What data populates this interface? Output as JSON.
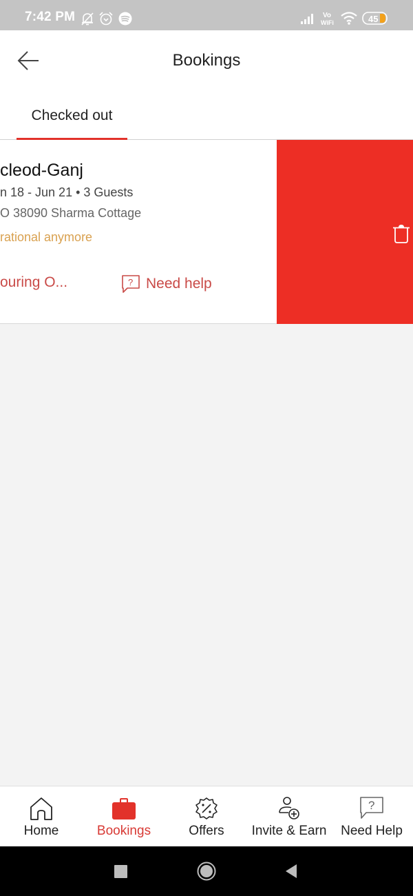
{
  "status_bar": {
    "time": "7:42 PM",
    "left_icons": [
      "bell-off-icon",
      "alarm-icon",
      "spotify-icon"
    ],
    "right_icons": [
      "signal-icon",
      "vowifi-icon",
      "wifi-icon",
      "battery-icon"
    ],
    "vowifi_text": "Vo WiFi",
    "battery_level": "45"
  },
  "app_bar": {
    "back_icon": "arrow-left-icon",
    "title": "Bookings"
  },
  "tabs": [
    {
      "label": "Checked out",
      "active": true
    }
  ],
  "booking_card": {
    "title": "cleod-Ganj",
    "dates_guests": "n 18 - Jun 21 • 3 Guests",
    "property": "O 38090 Sharma Cottage",
    "status": "rational anymore",
    "action_left": "ouring O...",
    "action_help": "Need help",
    "help_icon": "question-chat-icon"
  },
  "swipe_action": {
    "icon": "trash-icon",
    "color": "#ed2e25"
  },
  "bottom_nav": {
    "items": [
      {
        "label": "Home",
        "icon": "home-icon",
        "active": false
      },
      {
        "label": "Bookings",
        "icon": "briefcase-icon",
        "active": true
      },
      {
        "label": "Offers",
        "icon": "discount-badge-icon",
        "active": false
      },
      {
        "label": "Invite & Earn",
        "icon": "add-user-icon",
        "active": false
      },
      {
        "label": "Need Help",
        "icon": "question-chat-icon",
        "active": false
      }
    ],
    "active_color": "#e2322a"
  },
  "system_nav": {
    "buttons": [
      "recents-button",
      "home-button",
      "back-button"
    ]
  }
}
